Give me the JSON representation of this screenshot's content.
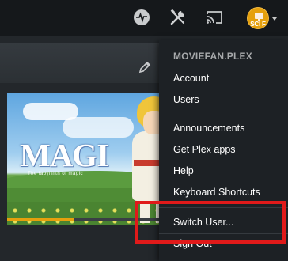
{
  "header": {
    "icons": {
      "activity": "activity-icon",
      "settings": "settings-icon",
      "cast": "cast-icon"
    },
    "avatar_text": "SCI F",
    "avatar_color": "#e5a00d"
  },
  "main": {
    "edit_icon": "pencil-icon",
    "poster": {
      "title": "MAGI",
      "subtitle": "The labyrinth of magic",
      "progress": 0.37
    }
  },
  "menu": {
    "username": "MOVIEFAN.PLEX",
    "items": [
      {
        "label": "Account"
      },
      {
        "label": "Users"
      },
      {
        "label": "Announcements"
      },
      {
        "label": "Get Plex apps"
      },
      {
        "label": "Help"
      },
      {
        "label": "Keyboard Shortcuts"
      },
      {
        "label": "Switch User..."
      },
      {
        "label": "Sign Out"
      }
    ]
  },
  "colors": {
    "accent": "#e5a00d",
    "highlight_box": "#e01a1a",
    "menu_bg": "#1d2125",
    "topbar_bg": "#15181b"
  }
}
